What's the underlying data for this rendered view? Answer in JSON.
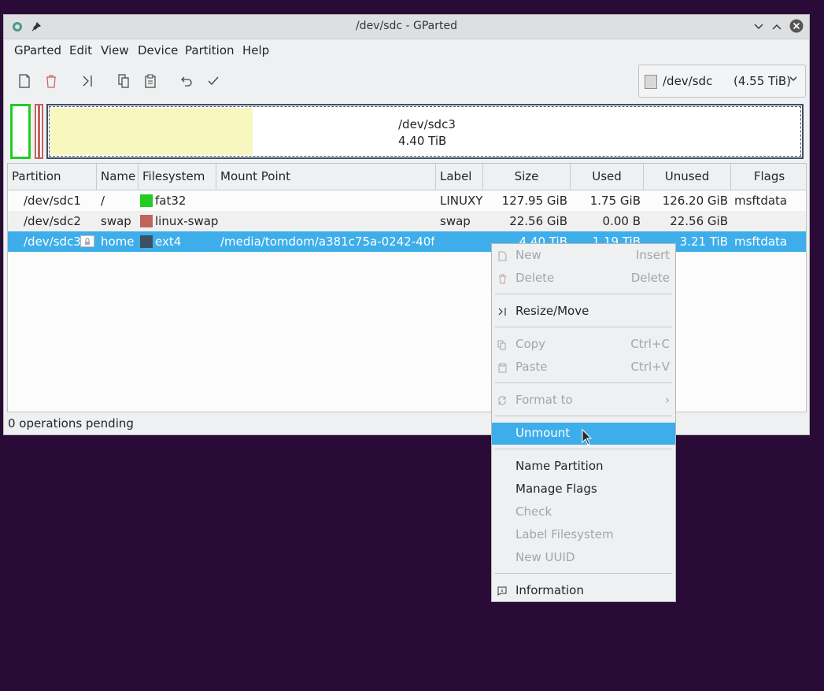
{
  "window": {
    "title": "/dev/sdc - GParted"
  },
  "menubar": [
    "GParted",
    "Edit",
    "View",
    "Device",
    "Partition",
    "Help"
  ],
  "device_selector": {
    "name": "/dev/sdc",
    "size": "(4.55 TiB)"
  },
  "diskmap": {
    "selected_name": "/dev/sdc3",
    "selected_size": "4.40 TiB",
    "used_fraction": 0.27
  },
  "table": {
    "columns": [
      "Partition",
      "Name",
      "Filesystem",
      "Mount Point",
      "Label",
      "Size",
      "Used",
      "Unused",
      "Flags"
    ],
    "rows": [
      {
        "partition": "/dev/sdc1",
        "name": "/",
        "filesystem": "fat32",
        "fs_color": "#22cc22",
        "mount": "",
        "label": "LINUXY",
        "size": "127.95 GiB",
        "used": "1.75 GiB",
        "unused": "126.20 GiB",
        "flags": "msftdata"
      },
      {
        "partition": "/dev/sdc2",
        "name": "swap",
        "filesystem": "linux-swap",
        "fs_color": "#c0635c",
        "mount": "",
        "label": "swap",
        "size": "22.56 GiB",
        "used": "0.00 B",
        "unused": "22.56 GiB",
        "flags": ""
      },
      {
        "partition": "/dev/sdc3",
        "name": "home",
        "filesystem": "ext4",
        "fs_color": "#3d4f63",
        "mount": "/media/tomdom/a381c75a-0242-40f...",
        "label": "",
        "size": "4.40 TiB",
        "used": "1.19 TiB",
        "unused": "3.21 TiB",
        "flags": "msftdata"
      }
    ]
  },
  "status": "0 operations pending",
  "context_menu": {
    "new": {
      "label": "New",
      "shortcut": "Insert"
    },
    "delete": {
      "label": "Delete",
      "shortcut": "Delete"
    },
    "resize": {
      "label": "Resize/Move"
    },
    "copy": {
      "label": "Copy",
      "shortcut": "Ctrl+C"
    },
    "paste": {
      "label": "Paste",
      "shortcut": "Ctrl+V"
    },
    "format": {
      "label": "Format to",
      "shortcut": "›"
    },
    "unmount": {
      "label": "Unmount"
    },
    "name_partition": {
      "label": "Name Partition"
    },
    "manage_flags": {
      "label": "Manage Flags"
    },
    "check": {
      "label": "Check"
    },
    "label_fs": {
      "label": "Label Filesystem"
    },
    "new_uuid": {
      "label": "New UUID"
    },
    "information": {
      "label": "Information"
    }
  }
}
